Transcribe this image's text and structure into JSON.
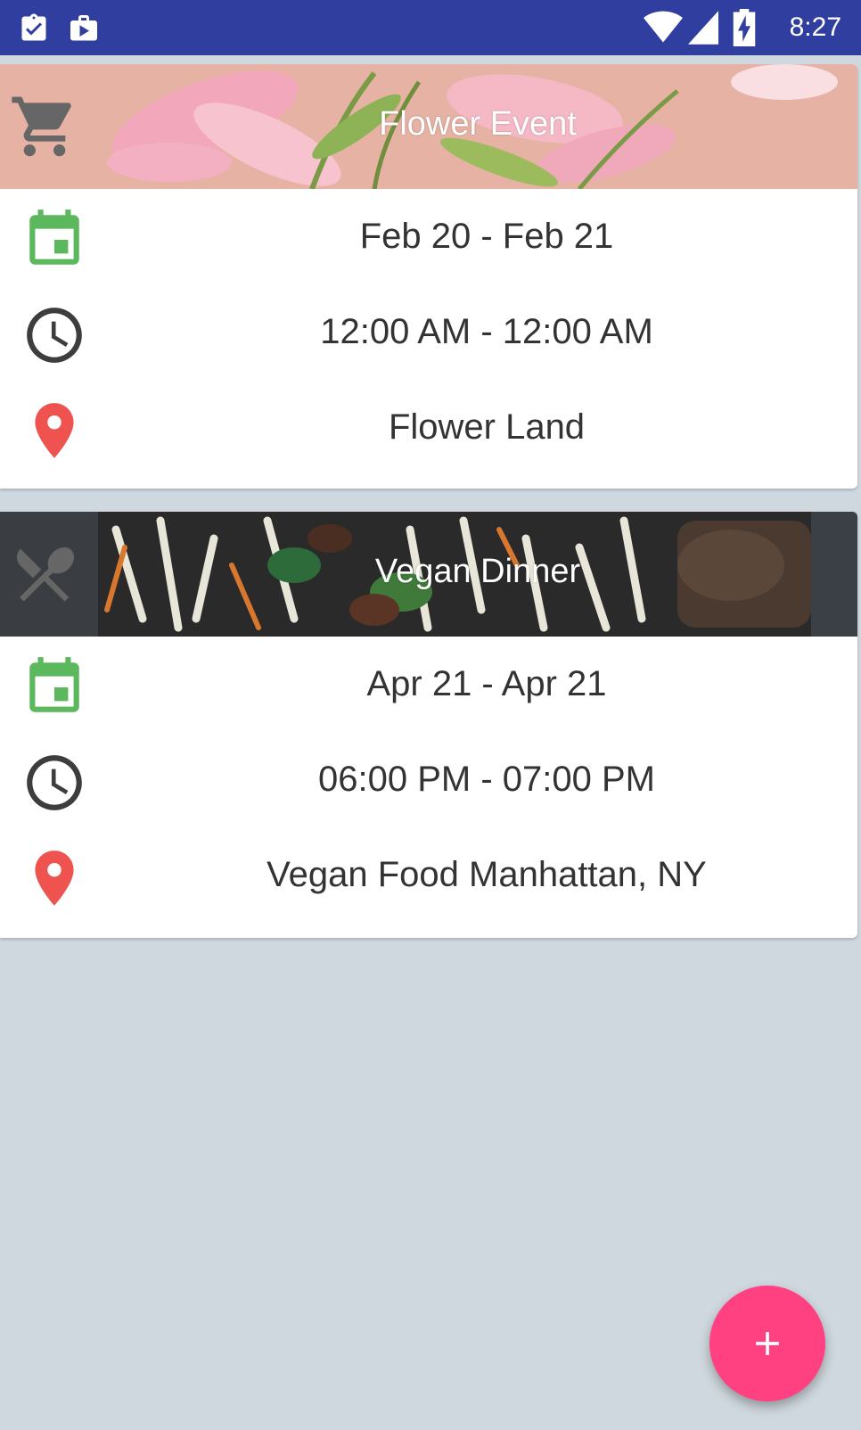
{
  "status_bar": {
    "time": "8:27",
    "left_icons": [
      "clipboard-check-icon",
      "briefcase-play-icon"
    ],
    "right_icons": [
      "wifi-icon",
      "cell-signal-icon",
      "battery-charging-icon"
    ]
  },
  "events": [
    {
      "title": "Flower Event",
      "category_icon": "cart-icon",
      "date_range": "Feb 20 - Feb 21",
      "time_range": "12:00 AM - 12:00 AM",
      "location": "Flower Land"
    },
    {
      "title": "Vegan Dinner",
      "category_icon": "utensils-icon",
      "date_range": "Apr 21 - Apr 21",
      "time_range": "06:00 PM - 07:00 PM",
      "location": "Vegan Food Manhattan, NY"
    }
  ],
  "fab": {
    "icon": "plus-icon"
  },
  "colors": {
    "status_bar": "#303f9f",
    "background": "#cfd8de",
    "calendar": "#5cb85c",
    "clock": "#3d3d3d",
    "location": "#ef5350",
    "fab": "#ff4081"
  }
}
